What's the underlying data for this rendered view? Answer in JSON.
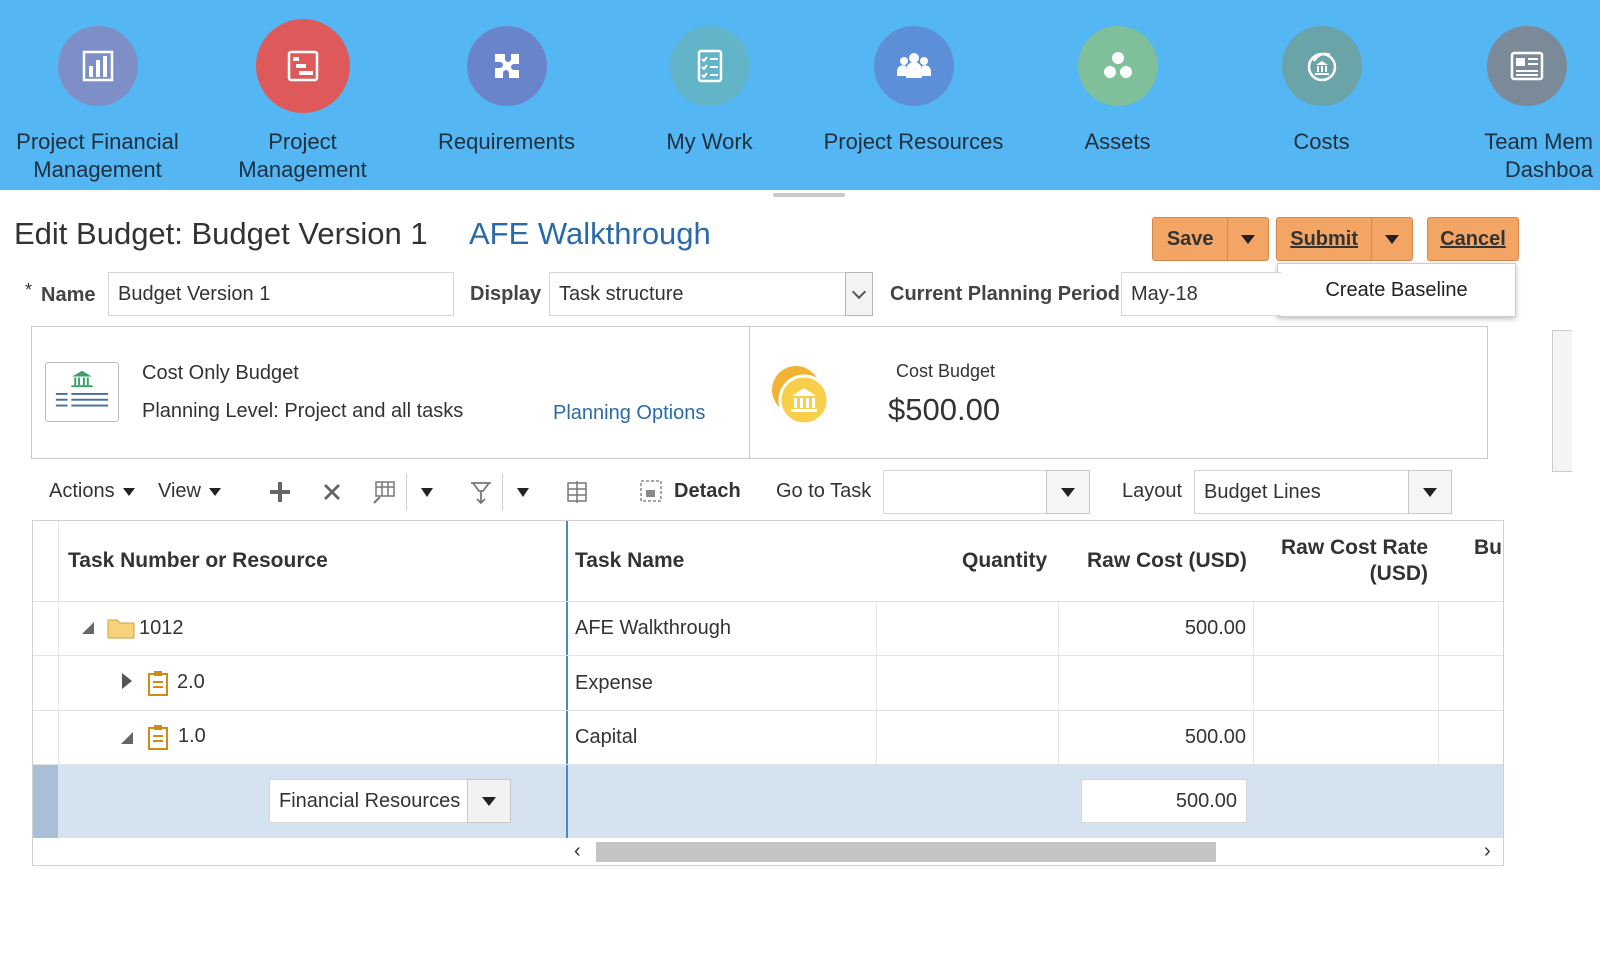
{
  "nav": {
    "items": [
      {
        "label": "Project Financial\nManagement",
        "color": "#7d8fc6",
        "icon": "bar-chart-icon"
      },
      {
        "label": "Project\nManagement",
        "color": "#de5a5a",
        "icon": "gantt-chart-icon"
      },
      {
        "label": "Requirements",
        "color": "#6a84cc",
        "icon": "puzzle-icon"
      },
      {
        "label": "My Work",
        "color": "#62b4c8",
        "icon": "checklist-icon"
      },
      {
        "label": "Project Resources",
        "color": "#5d8fd8",
        "icon": "people-group-icon"
      },
      {
        "label": "Assets",
        "color": "#7fbf9a",
        "icon": "circles-icon"
      },
      {
        "label": "Costs",
        "color": "#6aa3a8",
        "icon": "coins-bank-icon"
      },
      {
        "label": "Team Mem\nDashboa",
        "color": "#7a8a98",
        "icon": "dashboard-icon"
      }
    ]
  },
  "header": {
    "title": "Edit Budget: Budget Version 1",
    "project": "AFE Walkthrough",
    "save": "Save",
    "submit": "Submit",
    "cancel": "Cancel",
    "submit_menu_item": "Create Baseline"
  },
  "form": {
    "required_mark": "*",
    "name_label": "Name",
    "name_value": "Budget Version 1",
    "display_label": "Display",
    "display_value": "Task structure",
    "period_label": "Current Planning Period",
    "period_value": "May-18"
  },
  "summary": {
    "budget_type": "Cost Only Budget",
    "planning_level": "Planning Level: Project and all tasks",
    "planning_options": "Planning Options",
    "cost_budget_label": "Cost Budget",
    "cost_budget_value": "$500.00"
  },
  "toolbar": {
    "actions": "Actions",
    "view": "View",
    "detach": "Detach",
    "goto_label": "Go to Task",
    "goto_value": "",
    "layout_label": "Layout",
    "layout_value": "Budget Lines"
  },
  "table": {
    "headers": {
      "task_number": "Task Number or Resource",
      "task_name": "Task Name",
      "quantity": "Quantity",
      "raw_cost": "Raw Cost (USD)",
      "raw_cost_rate_1": "Raw Cost Rate",
      "raw_cost_rate_2": "(USD)",
      "bu": "Bu"
    },
    "rows": [
      {
        "number": "1012",
        "name": "AFE Walkthrough",
        "raw_cost": "500.00"
      },
      {
        "number": "2.0",
        "name": "Expense",
        "raw_cost": ""
      },
      {
        "number": "1.0",
        "name": "Capital",
        "raw_cost": "500.00"
      }
    ],
    "edit_row": {
      "resource": "Financial Resources",
      "raw_cost": "500.00"
    }
  },
  "scroll": {
    "left": "‹",
    "right": "›"
  }
}
